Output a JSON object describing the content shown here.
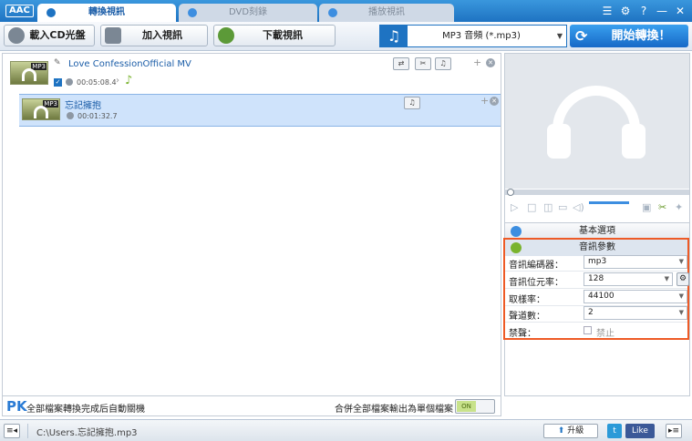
{
  "app": {
    "logo": "AAC"
  },
  "tabs": [
    {
      "label": "轉換視訊",
      "icon": "convert-icon"
    },
    {
      "label": "DVD刻錄",
      "icon": "dvd-icon"
    },
    {
      "label": "播放視訊",
      "icon": "play-icon"
    }
  ],
  "window_buttons": {
    "menu": "☰",
    "settings": "⚙",
    "help": "?",
    "minimize": "—",
    "close": "✕"
  },
  "toolbar": {
    "load_cd": "載入CD光盤",
    "add_video": "加入視訊",
    "download_video": "下載視訊",
    "format": "MP3 音頻 (*.mp3)",
    "start": "開始轉換！"
  },
  "files": [
    {
      "name": "Love ConfessionOfficial MV",
      "duration": "00:05:08.4",
      "badge": "MP3"
    },
    {
      "name": "忘記擁抱",
      "duration": "00:01:32.7",
      "badge": "MP3"
    }
  ],
  "sections": {
    "basic": "基本選項",
    "audio": "音訊參數"
  },
  "params": [
    {
      "label": "音訊編碼器：",
      "value": "mp3"
    },
    {
      "label": "音訊位元率：",
      "value": "128"
    },
    {
      "label": "取樣率：",
      "value": "44100"
    },
    {
      "label": "聲道數：",
      "value": "2"
    },
    {
      "label": "禁聲：",
      "value": "禁止"
    }
  ],
  "bottom": {
    "auto_shutdown": "全部檔案轉換完成后自動關機",
    "merge": "合併全部檔案輸出為單個檔案",
    "toggle": "ON",
    "pl_logo": "PK"
  },
  "status": {
    "path": "C:\\Users.忘記擁抱.mp3",
    "upgrade": "升級",
    "like": "Like"
  },
  "colors": {
    "accent": "#1e73c2",
    "highlight_box": "#ee5a26",
    "selected_row": "#cfe3fb"
  }
}
